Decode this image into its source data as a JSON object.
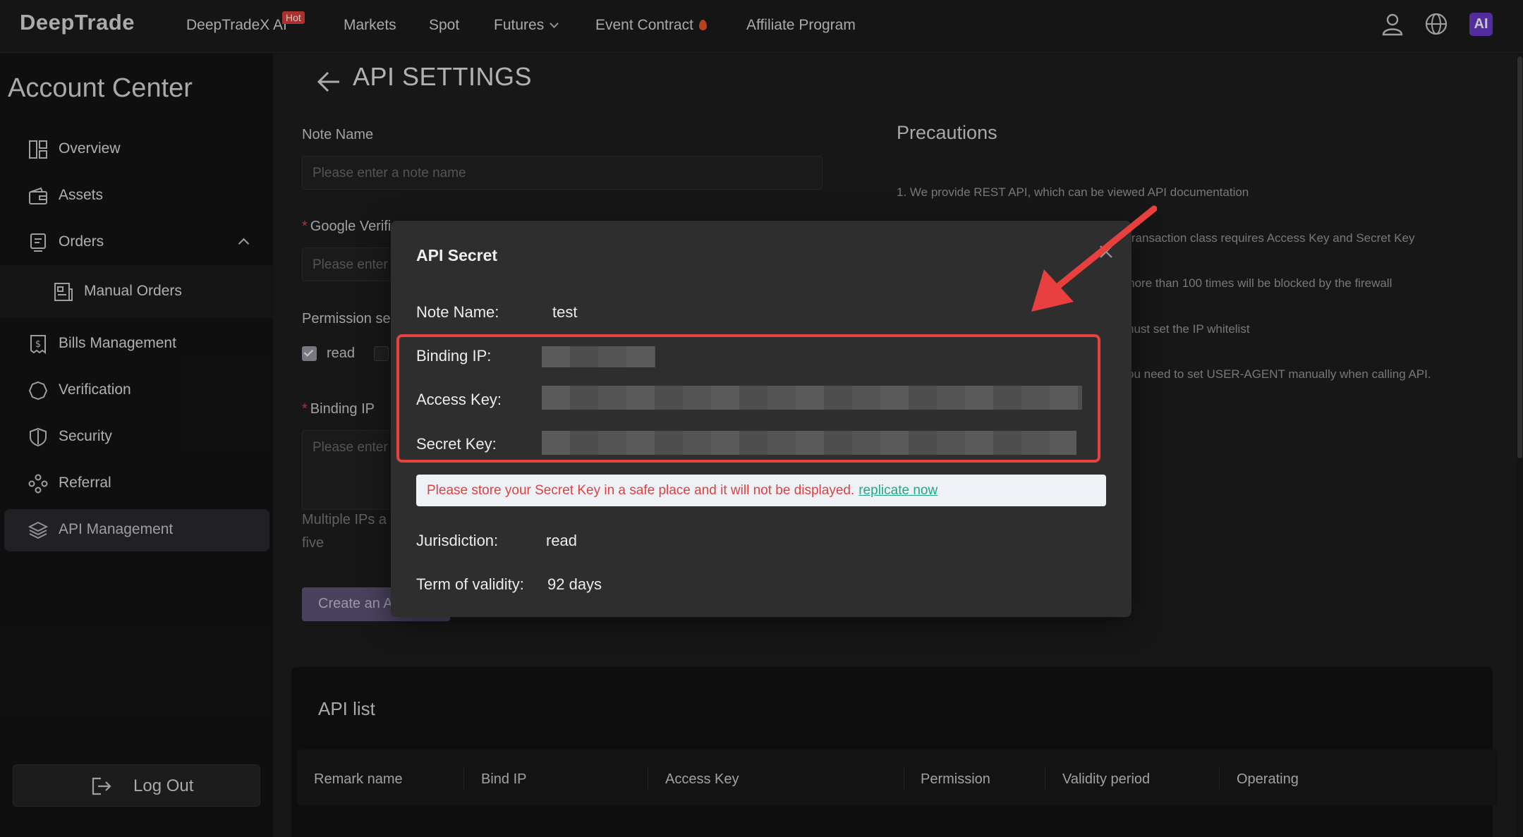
{
  "topbar": {
    "logo": "DeepTrade",
    "nav": [
      "DeepTradeX AI",
      "Markets",
      "Spot",
      "Futures",
      "Event Contract",
      "Affiliate Program"
    ],
    "hot_badge": "Hot",
    "ai_badge": "AI"
  },
  "sidebar": {
    "title": "Account Center",
    "items": [
      {
        "label": "Overview",
        "icon": "layout-icon"
      },
      {
        "label": "Assets",
        "icon": "wallet-icon"
      },
      {
        "label": "Orders",
        "icon": "document-icon"
      },
      {
        "label": "Manual Orders",
        "icon": "newspaper-icon"
      },
      {
        "label": "Bills Management",
        "icon": "bill-icon"
      },
      {
        "label": "Verification",
        "icon": "badge-icon"
      },
      {
        "label": "Security",
        "icon": "shield-icon"
      },
      {
        "label": "Referral",
        "icon": "network-icon"
      },
      {
        "label": "API Management",
        "icon": "layers-icon"
      }
    ],
    "logout": "Log Out"
  },
  "main": {
    "title": "API SETTINGS",
    "note_name_label": "Note Name",
    "note_name_placeholder": "Please enter a note name",
    "google_label": "Google Verifi",
    "google_placeholder": "Please enter",
    "permission_label": "Permission se",
    "permission_read": "read",
    "binding_ip_label": "Binding IP",
    "binding_ip_placeholder": "Please enter",
    "multiple_ips_hint_1": "Multiple IPs a",
    "multiple_ips_hint_2": "five",
    "create_button": "Create an A",
    "precautions_title": "Precautions",
    "precautions": [
      "1. We provide REST API, which can be viewed API documentation",
      "e transaction class requires Access Key and Secret Key",
      ", more than 100 times will be blocked by the firewall",
      "nust set the IP whitelist",
      "ou need to set USER-AGENT manually when calling API."
    ],
    "api_list_title": "API list",
    "api_list_columns": [
      "Remark name",
      "Bind IP",
      "Access Key",
      "Permission",
      "Validity period",
      "Operating"
    ]
  },
  "modal": {
    "title": "API Secret",
    "note_name_label": "Note Name:",
    "note_name_value": "test",
    "binding_ip_label": "Binding IP:",
    "access_key_label": "Access Key:",
    "secret_key_label": "Secret Key:",
    "notice_text": "Please store your Secret Key in a safe place and it will not be displayed.",
    "notice_link": "replicate now",
    "jurisdiction_label": "Jurisdiction:",
    "jurisdiction_value": "read",
    "validity_label": "Term of validity:",
    "validity_value": "92 days"
  },
  "colors": {
    "accent_red": "#e8403f",
    "link_green": "#1fa987",
    "button_purple": "#5e5478"
  }
}
